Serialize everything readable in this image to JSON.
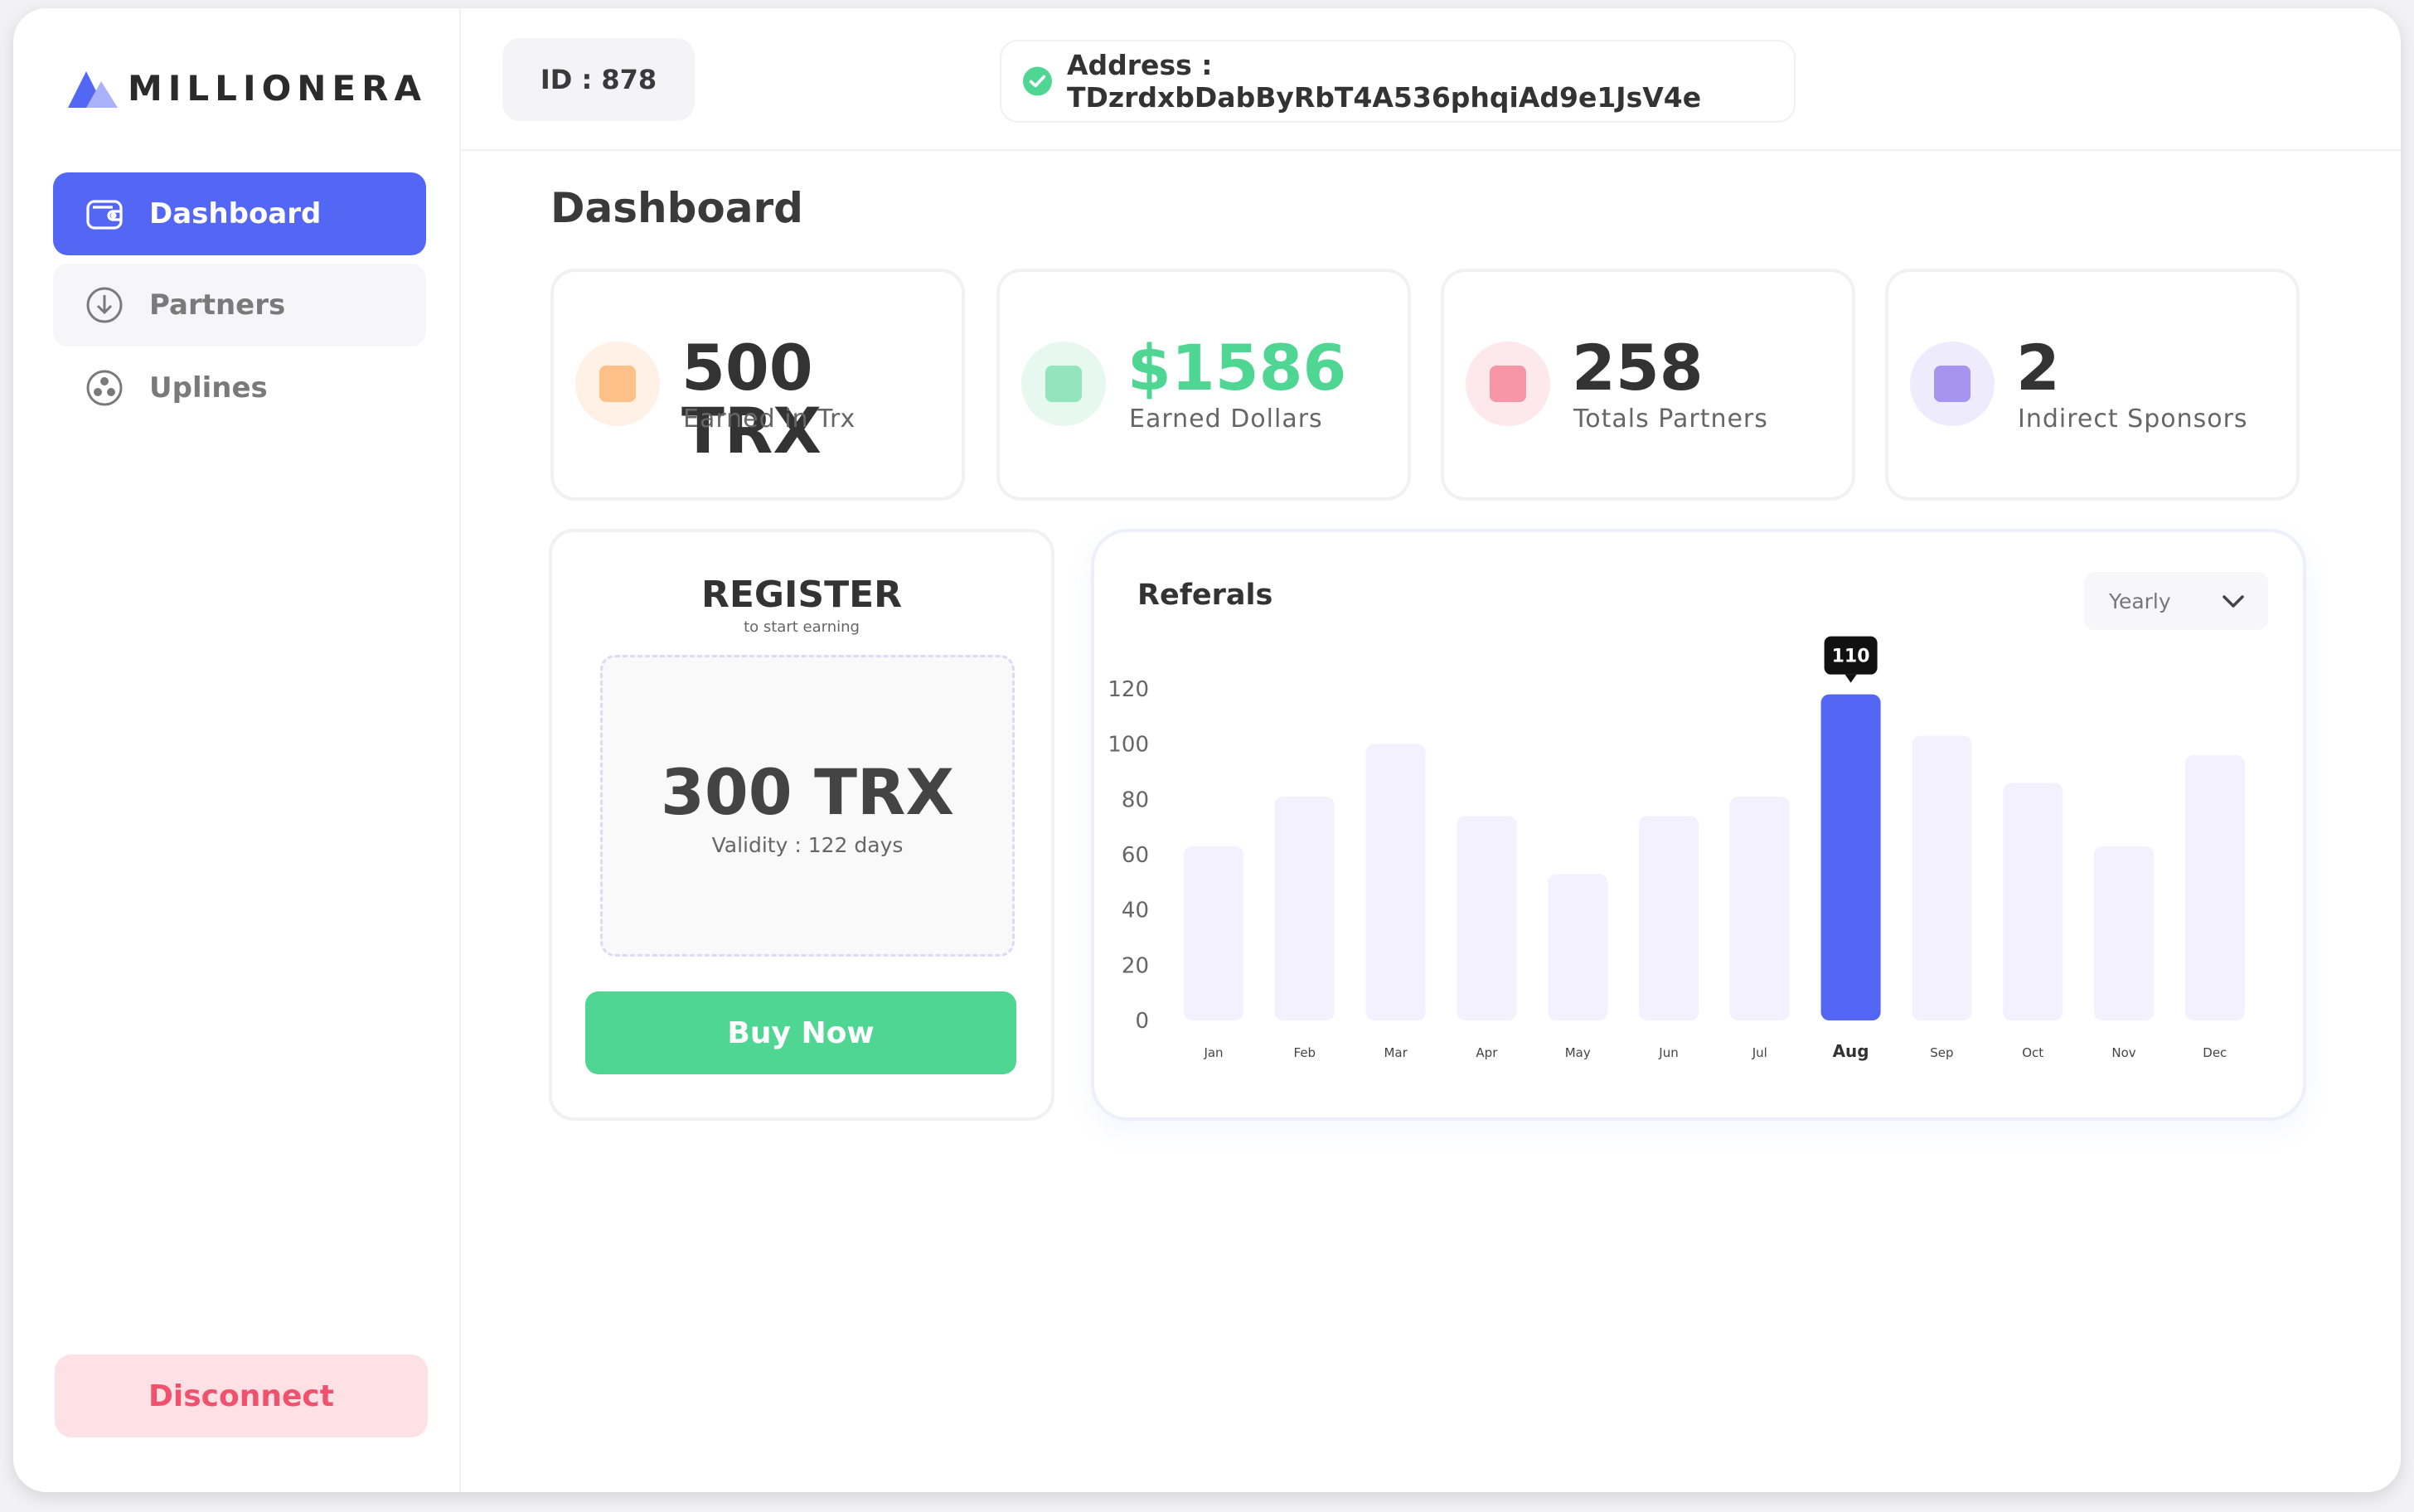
{
  "brand": {
    "name": "MILLIONERA"
  },
  "sidebar": {
    "items": [
      {
        "label": "Dashboard",
        "icon": "wallet-icon",
        "active": true
      },
      {
        "label": "Partners",
        "icon": "download-circle-icon"
      },
      {
        "label": "Uplines",
        "icon": "users-circle-icon"
      }
    ],
    "disconnect_label": "Disconnect"
  },
  "topbar": {
    "id_text": "ID : 878",
    "address_text": "Address : TDzrdxbDabByRbT4A536phqiAd9e1JsV4e"
  },
  "page": {
    "title": "Dashboard"
  },
  "stats": [
    {
      "value": "500 TRX",
      "label": "Earned  in Trx",
      "icon_bg": "#fff1e6",
      "icon_color": "#ff9a3c",
      "value_color": "#333333"
    },
    {
      "value": "$1586",
      "label": "Earned  Dollars",
      "icon_bg": "#e6f8ef",
      "icon_color": "#4fd693",
      "value_color": "#4fd693"
    },
    {
      "value": "258",
      "label": "Totals Partners",
      "icon_bg": "#fde9ec",
      "icon_color": "#f0516d",
      "value_color": "#333333"
    },
    {
      "value": "2",
      "label": "Indirect Sponsors",
      "icon_bg": "#eeebfd",
      "icon_color": "#6b4ee6",
      "value_color": "#333333"
    }
  ],
  "register": {
    "title": "REGISTER",
    "subtitle": "to start earning",
    "amount": "300 TRX",
    "validity": "Validity : 122  days",
    "button_label": "Buy Now"
  },
  "referrals": {
    "title": "Referals",
    "period_select": "Yearly"
  },
  "chart_data": {
    "type": "bar",
    "categories": [
      "Jan",
      "Feb",
      "Mar",
      "Apr",
      "May",
      "Jun",
      "Jul",
      "Aug",
      "Sep",
      "Oct",
      "Nov",
      "Dec"
    ],
    "values": [
      63,
      81,
      100,
      74,
      53,
      74,
      81,
      118,
      103,
      86,
      63,
      96
    ],
    "highlight_index": 7,
    "tooltip": "110",
    "yticks": [
      0,
      20,
      40,
      60,
      80,
      100,
      120
    ],
    "ylim": [
      0,
      120
    ],
    "bar_color": "#f3f1fd",
    "highlight_color": "#5466f4"
  }
}
